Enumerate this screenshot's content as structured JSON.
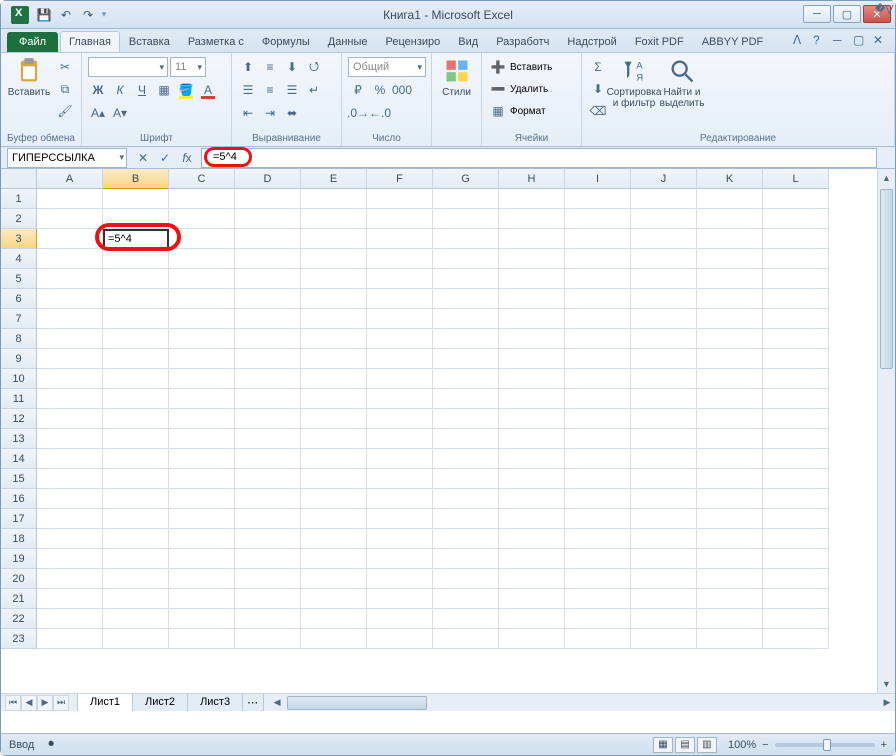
{
  "window": {
    "title": "Книга1 - Microsoft Excel"
  },
  "qat": {
    "save": "save-icon",
    "undo": "undo-icon",
    "redo": "redo-icon"
  },
  "tabs": {
    "file": "Файл",
    "items": [
      "Главная",
      "Вставка",
      "Разметка с",
      "Формулы",
      "Данные",
      "Рецензиро",
      "Вид",
      "Разработч",
      "Надстрой",
      "Foxit PDF",
      "ABBYY PDF"
    ],
    "active_index": 0
  },
  "ribbon": {
    "clipboard": {
      "label": "Буфер обмена",
      "paste": "Вставить"
    },
    "font": {
      "label": "Шрифт",
      "name": "",
      "size": "11"
    },
    "alignment": {
      "label": "Выравнивание"
    },
    "number": {
      "label": "Число",
      "format": "Общий"
    },
    "styles": {
      "label": "",
      "btn": "Стили"
    },
    "cells": {
      "label": "Ячейки",
      "insert": "Вставить",
      "delete": "Удалить",
      "format": "Формат"
    },
    "editing": {
      "label": "Редактирование",
      "sort": "Сортировка и фильтр",
      "find": "Найти и выделить"
    }
  },
  "formula_bar": {
    "name_box": "ГИПЕРССЫЛКА",
    "formula": "=5^4"
  },
  "grid": {
    "columns": [
      "A",
      "B",
      "C",
      "D",
      "E",
      "F",
      "G",
      "H",
      "I",
      "J",
      "K",
      "L"
    ],
    "active_col_index": 1,
    "rows": 23,
    "active_row": 3,
    "editing_cell": {
      "row": 3,
      "col": 1,
      "value": "=5^4"
    }
  },
  "sheets": {
    "items": [
      "Лист1",
      "Лист2",
      "Лист3"
    ],
    "active_index": 0
  },
  "status": {
    "mode": "Ввод",
    "zoom": "100%"
  }
}
